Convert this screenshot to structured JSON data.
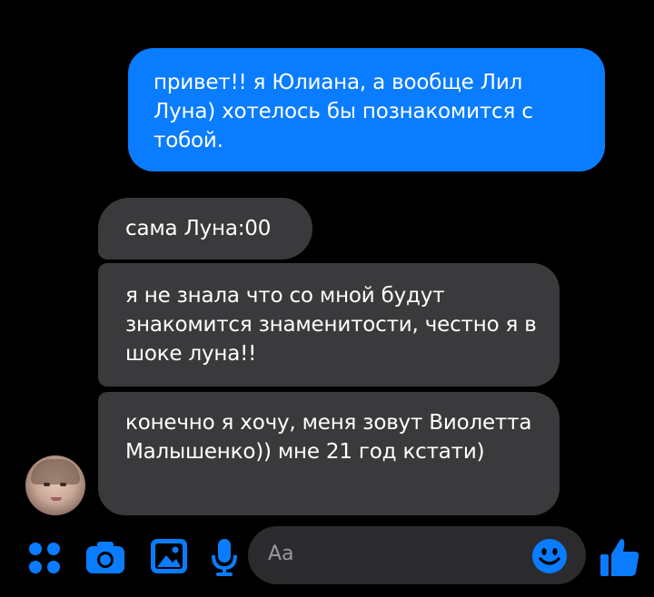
{
  "messages": [
    {
      "direction": "outgoing",
      "text": "привет!! я Юлиана, а вообще Лил Луна) хотелось бы познакомится с тобой."
    },
    {
      "direction": "incoming",
      "text": "сама Луна:00"
    },
    {
      "direction": "incoming",
      "text": "я не знала что со мной будут знакомится знаменитости, честно я в шоке луна!!"
    },
    {
      "direction": "incoming",
      "text": "конечно я хочу, меня зовут Виолетта Малышенко)) мне 21 год кстати)"
    }
  ],
  "composer": {
    "placeholder": "Aa"
  },
  "colors": {
    "accent": "#0a7cff",
    "incoming_bubble": "#3a3a3c",
    "background": "#000000"
  },
  "icons": [
    "more-dots-icon",
    "camera-icon",
    "gallery-icon",
    "microphone-icon",
    "emoji-icon",
    "thumbs-up-icon"
  ]
}
